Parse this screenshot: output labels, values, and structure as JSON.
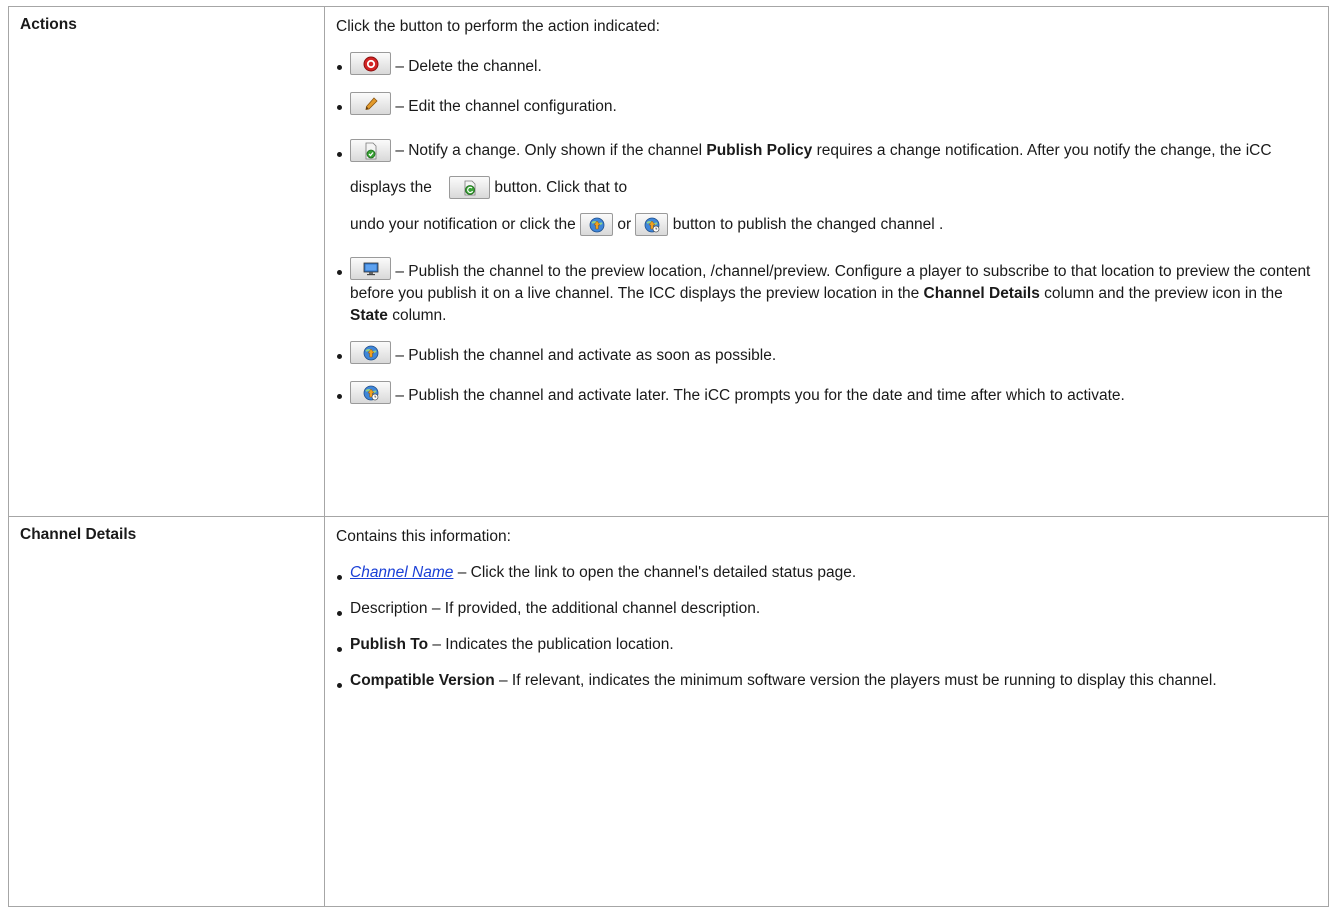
{
  "rows": [
    {
      "term": "Actions",
      "intro": "Click the button to perform the action indicated:",
      "items": {
        "delete": "– Delete the channel.",
        "edit": "– Edit the channel configuration.",
        "notify_a": "– Notify a change. Only shown if the channel ",
        "notify_bold": "Publish Policy",
        "notify_b": " requires a change notification. After you notify the change, the iCC displays the ",
        "notify_c": " button. Click that to",
        "notify_d": "undo your notification or click the ",
        "notify_or": " or ",
        "notify_e": " button to publish the changed channel .",
        "preview_a": "– Publish the channel to the preview location, /channel/preview. Configure a player to subscribe to that location to preview the content before you publish it on a live channel. The ICC displays the preview location in the ",
        "preview_bold1": "Channel Details",
        "preview_b": " column and the preview icon in the ",
        "preview_bold2": "State",
        "preview_c": " column.",
        "publish_now": "– Publish the channel and activate as soon as possible.",
        "publish_later": "– Publish the channel and activate later. The iCC prompts you for the date and time after which to activate."
      }
    },
    {
      "term": "Channel Details",
      "intro": "Contains this information:",
      "items": {
        "name_link": "Channel Name",
        "name_rest": " – Click the link to open the channel's detailed status page.",
        "description": "Description – If provided, the additional channel description.",
        "publish_to_bold": "Publish To",
        "publish_to_rest": " – Indicates the publication location.",
        "compat_bold": "Compatible Version",
        "compat_rest": " – If relevant, indicates the minimum software version the players must be running to display this channel."
      }
    }
  ],
  "icons": {
    "delete": "delete-icon",
    "edit": "pencil-icon",
    "notify": "notify-document-icon",
    "undo_notify": "undo-notify-icon",
    "publish_now": "publish-globe-icon",
    "publish_later": "publish-later-globe-icon",
    "preview": "monitor-icon"
  }
}
